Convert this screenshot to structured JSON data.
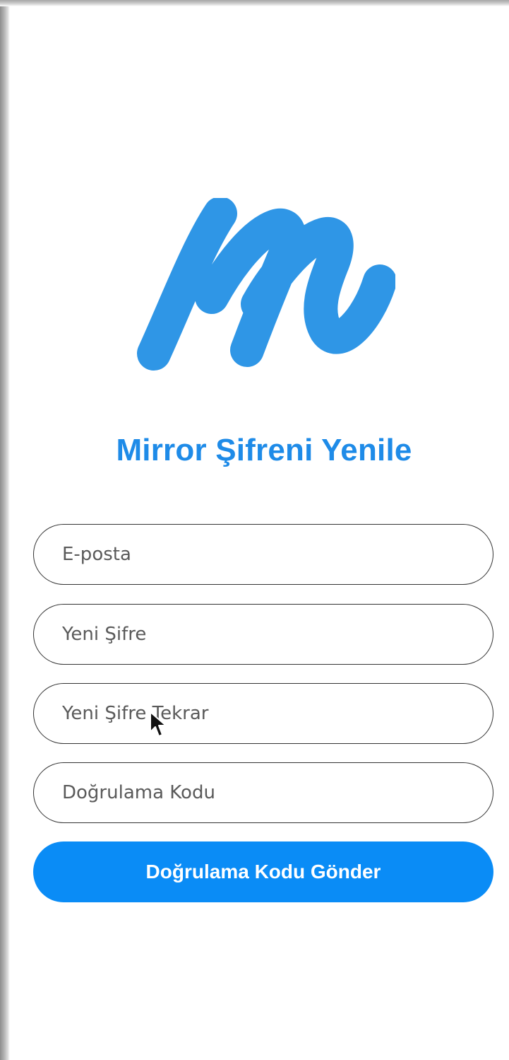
{
  "app": {
    "title": "Mirror Şifreni Yenile",
    "accent_color": "#1e8be8",
    "button_color": "#0a8cf6",
    "logo_icon": "mirror-m-logo"
  },
  "form": {
    "email_placeholder": "E-posta",
    "new_password_placeholder": "Yeni Şifre",
    "new_password_repeat_placeholder": "Yeni Şifre Tekrar",
    "verification_code_placeholder": "Doğrulama Kodu",
    "submit_label": "Doğrulama Kodu Gönder"
  }
}
